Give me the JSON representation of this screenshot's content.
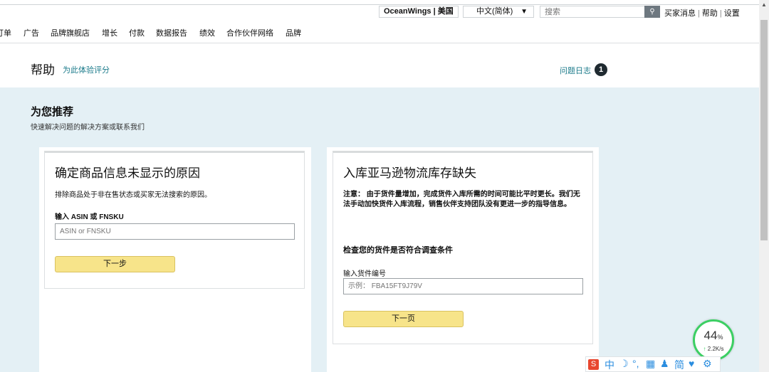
{
  "topbar": {
    "store": "OceanWings | 美国",
    "language": "中文(简体)",
    "search_placeholder": "搜索",
    "links": [
      "买家消息",
      "帮助",
      "设置"
    ]
  },
  "nav": [
    "订单",
    "广告",
    "品牌旗舰店",
    "增长",
    "付款",
    "数据报告",
    "绩效",
    "合作伙伴网络",
    "品牌"
  ],
  "help": {
    "title": "帮助",
    "rate": "为此体验评分",
    "issue_log": "问题日志",
    "issue_count": "1"
  },
  "recommend": {
    "title": "为您推荐",
    "subtitle": "快速解决问题的解决方案或联系我们"
  },
  "card1": {
    "title": "确定商品信息未显示的原因",
    "desc": "排除商品处于非在售状态或买家无法搜索的原因。",
    "label": "输入 ASIN 或 FNSKU",
    "placeholder": "ASIN or FNSKU",
    "button": "下一步"
  },
  "card2": {
    "title": "入库亚马逊物流库存缺失",
    "note": "注意： 由于货件量增加，完成货件入库所需的时间可能比平时更长。我们无法手动加快货件入库流程，销售伙伴支持团队没有更进一步的指导信息。",
    "check_title": "检查您的货件是否符合调查条件",
    "label": "输入货件编号",
    "placeholder": "示例： FBA15FT9J79V",
    "button": "下一页"
  },
  "speed_widget": {
    "percent": "44",
    "percent_unit": "%",
    "rate": "2.2K/s"
  },
  "ime": {
    "logo": "S",
    "items": [
      "中",
      "☽",
      "°,",
      "▦",
      "♟",
      "简",
      "♥",
      "⚙"
    ]
  }
}
